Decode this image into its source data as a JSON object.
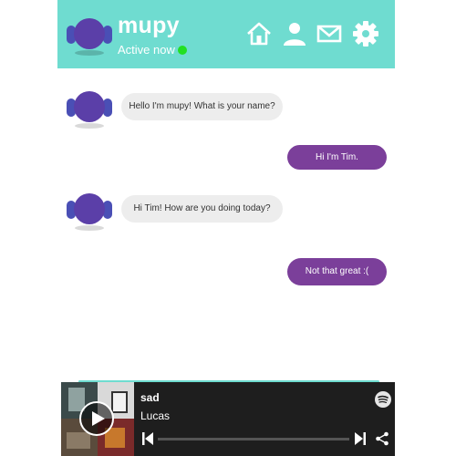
{
  "colors": {
    "header_bg": "#6fdcd0",
    "accent_purple": "#6b3fa0",
    "user_bubble": "#7b3f9a",
    "bot_bubble": "#ededed",
    "status_online": "#22e022",
    "player_bg": "#1e1e1e"
  },
  "header": {
    "title": "mupy",
    "status": "Active now",
    "icons": [
      "home-icon",
      "profile-icon",
      "mail-icon",
      "settings-icon"
    ]
  },
  "messages": [
    {
      "sender": "bot",
      "text": "Hello I'm mupy! What is your name?"
    },
    {
      "sender": "user",
      "text": "Hi I'm Tim."
    },
    {
      "sender": "bot",
      "text": "Hi Tim! How are you doing today?"
    },
    {
      "sender": "user",
      "text": "Not that great :("
    }
  ],
  "player": {
    "track": "sad",
    "artist": "Lucas",
    "progress": 0,
    "icons": [
      "play-icon",
      "spotify-icon",
      "previous-icon",
      "next-icon",
      "share-icon"
    ]
  }
}
